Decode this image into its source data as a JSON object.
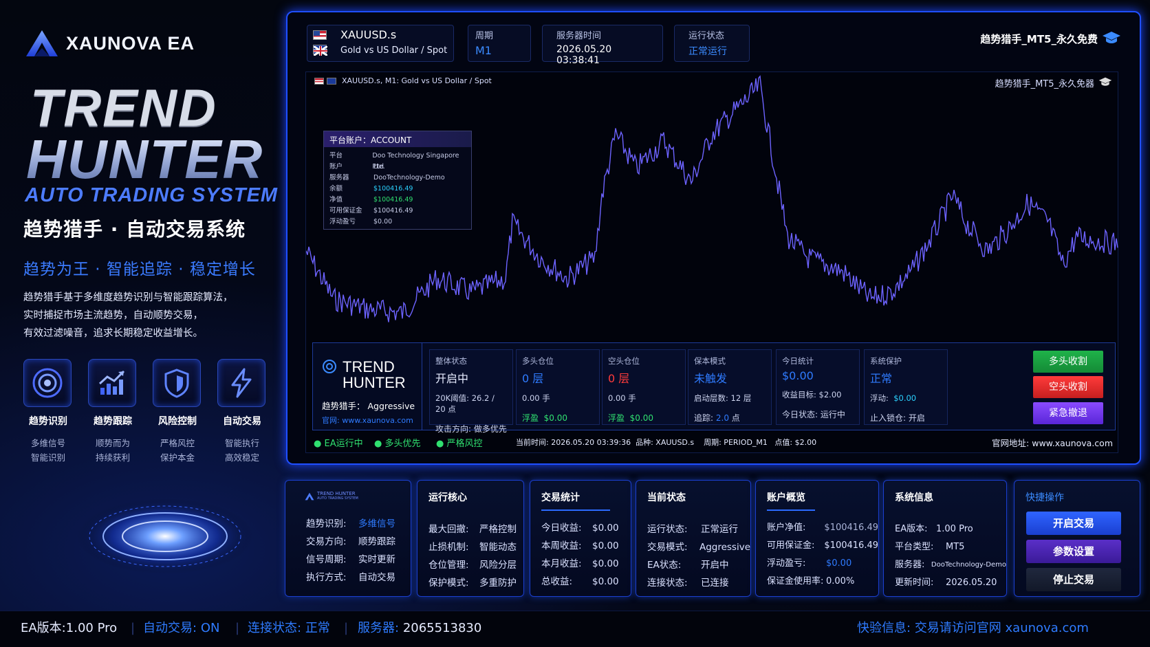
{
  "brand": {
    "name": "XAUNOVA EA"
  },
  "hero": {
    "line1": "TREND",
    "line2": "HUNTER",
    "line3": "AUTO TRADING SYSTEM",
    "cn_title": "趋势猎手 · 自动交易系统",
    "slogan": "趋势为王 · 智能追踪 · 稳定增长",
    "desc": [
      "趋势猎手基于多维度趋势识别与智能跟踪算法，",
      "实时捕捉市场主流趋势，自动顺势交易，",
      "有效过滤噪音，追求长期稳定收益增长。"
    ]
  },
  "features": [
    {
      "icon": "target-icon",
      "title": "趋势识别",
      "sub1": "多维信号",
      "sub2": "智能识别"
    },
    {
      "icon": "trend-chart-icon",
      "title": "趋势跟踪",
      "sub1": "顺势而为",
      "sub2": "持续获利"
    },
    {
      "icon": "shield-icon",
      "title": "风险控制",
      "sub1": "严格风控",
      "sub2": "保护本金"
    },
    {
      "icon": "lightning-icon",
      "title": "自动交易",
      "sub1": "智能执行",
      "sub2": "高效稳定"
    }
  ],
  "header": {
    "symbol": "XAUUSD.s",
    "symbol_desc": "Gold vs US Dollar / Spot",
    "period_label": "周期",
    "period": "M1",
    "server_time_label": "服务器时间",
    "server_time": "2026.05.20 03:38:41",
    "run_label": "运行状态",
    "run_status": "正常运行",
    "ea_name": "趋势猎手_MT5_永久免费"
  },
  "chart": {
    "caption": "XAUUSD.s, M1:  Gold vs US Dollar / Spot",
    "ea_name": "趋势猎手_MT5_永久免器"
  },
  "account": {
    "title": "平台账户：ACCOUNT",
    "rows": [
      {
        "k": "平台",
        "v": "Doo Technology Singapore Pte."
      },
      {
        "k": "账户",
        "v": "Ltd"
      },
      {
        "k": "服务器",
        "v": "DooTechnology-Demo"
      },
      {
        "k": "余额",
        "v": "$100416.49"
      },
      {
        "k": "净值",
        "v": "$100416.49"
      },
      {
        "k": "可用保证金",
        "v": "$100416.49"
      },
      {
        "k": "浮动盈亏",
        "v": "$0.00"
      }
    ]
  },
  "status_panel": {
    "logo1": "TREND",
    "logo2": "HUNTER",
    "sub": "趋势猎手：  Aggressive",
    "site": "官网: www.xaunova.com",
    "cells": [
      {
        "label": "整体状态",
        "big": "开启中",
        "s1": "20K阈值: 26.2 / 20 点",
        "s2": "攻击方向: 做多优先"
      },
      {
        "label": "多头仓位",
        "big": "0 层",
        "s1": "0.00 手",
        "s2a": "浮盈",
        "s2b": "$0.00"
      },
      {
        "label": "空头仓位",
        "big": "0 层",
        "s1": "0.00 手",
        "s2a": "浮盈",
        "s2b": "$0.00"
      },
      {
        "label": "保本模式",
        "big": "未触发",
        "s1": "启动层数: 12 层",
        "s2a": "追踪:",
        "s2b": "2.0",
        "s2c": "点"
      },
      {
        "label": "今日统计",
        "big": "$0.00",
        "s1": "收益目标: $2.00",
        "s2": "今日状态: 运行中"
      },
      {
        "label": "系统保护",
        "big": "正常",
        "s1a": "浮动:",
        "s1b": "$0.00",
        "s2": "止入锁仓: 开启"
      }
    ],
    "btn_long": "多头收割",
    "btn_short": "空头收割",
    "btn_exit": "紧急撤退",
    "tags": [
      "EA运行中",
      "多头优先",
      "严格风控"
    ],
    "info": "当前时间: 2026.05.20 03:39:36  品种: XAUUSD.s    周期: PERIOD_M1   点值: $2.00",
    "site_right": "官网地址: www.xaunova.com"
  },
  "cards": {
    "logo_text": "TREND HUNTER",
    "logo_sub": "AUTO TRADING SYSTEM",
    "c1": [
      {
        "k": "趋势识别:",
        "v": "多维信号"
      },
      {
        "k": "交易方向:",
        "v": "顺势跟踪"
      },
      {
        "k": "信号周期:",
        "v": "实时更新"
      },
      {
        "k": "执行方式:",
        "v": "自动交易"
      }
    ],
    "c2": {
      "title": "运行核心",
      "rows": [
        {
          "k": "最大回撤:",
          "v": "严格控制"
        },
        {
          "k": "止损机制:",
          "v": "智能动态"
        },
        {
          "k": "仓位管理:",
          "v": "风险分层"
        },
        {
          "k": "保护模式:",
          "v": "多重防护"
        }
      ]
    },
    "c3": {
      "title": "交易统计",
      "rows": [
        {
          "k": "今日收益:",
          "v": "$0.00"
        },
        {
          "k": "本周收益:",
          "v": "$0.00"
        },
        {
          "k": "本月收益:",
          "v": "$0.00"
        },
        {
          "k": "总收益:",
          "v": "$0.00"
        }
      ]
    },
    "c4": {
      "title": "当前状态",
      "rows": [
        {
          "k": "运行状态:",
          "v": "正常运行"
        },
        {
          "k": "交易模式:",
          "v": "Aggressive"
        },
        {
          "k": "EA状态:",
          "v": "开启中"
        },
        {
          "k": "连接状态:",
          "v": "已连接"
        }
      ]
    },
    "c5": {
      "title": "账户概览",
      "rows": [
        {
          "k": "账户净值:",
          "v": "$100416.49"
        },
        {
          "k": "可用保证金:",
          "v": "$100416.49"
        },
        {
          "k": "浮动盈亏:",
          "v": "$0.00"
        },
        {
          "k": "保证金使用率:",
          "v": "0.00%"
        }
      ]
    },
    "c6": {
      "title": "系统信息",
      "rows": [
        {
          "k": "EA版本:",
          "v": "1.00 Pro"
        },
        {
          "k": "平台类型:",
          "v": "MT5"
        },
        {
          "k": "服务器:",
          "v": "DooTechnology-Demo"
        },
        {
          "k": "更新时间:",
          "v": "2026.05.20"
        }
      ]
    },
    "c7": {
      "title": "快捷操作",
      "b1": "开启交易",
      "b2": "参数设置",
      "b3": "停止交易"
    }
  },
  "footer": {
    "version_label": "EA版本:",
    "version": "1.00 Pro",
    "auto_label": "自动交易:",
    "auto": "ON",
    "conn_label": "连接状态:",
    "conn": "正常",
    "server_label": "服务器:",
    "server": "2065513830",
    "right_label": "快验信息:",
    "right": "交易请访问官网 xaunova.com"
  },
  "colors": {
    "accent": "#1f4fff",
    "green": "#30e070",
    "red": "#ff3b3b",
    "cyan": "#2bd2ff",
    "purple": "#7b3dff"
  }
}
